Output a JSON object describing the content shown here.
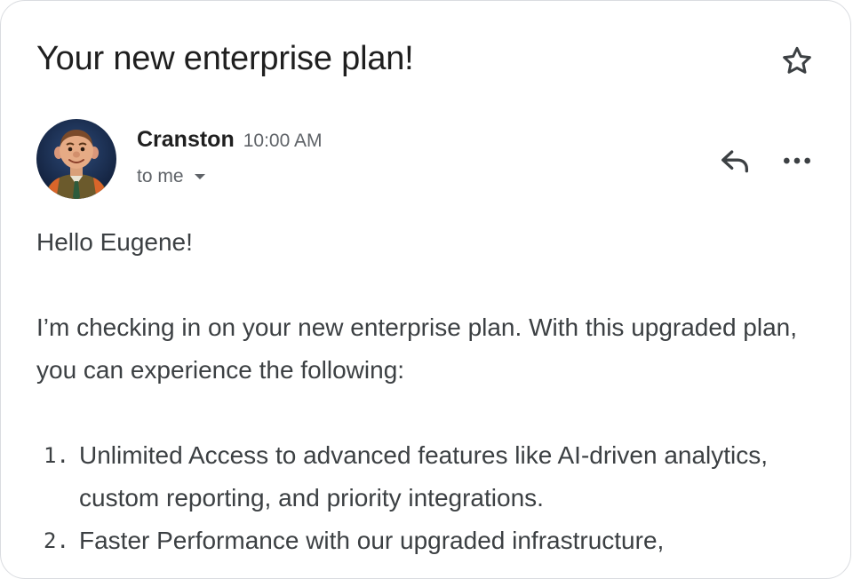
{
  "email": {
    "subject": "Your new enterprise plan!",
    "sender_name": "Cranston",
    "time": "10:00 AM",
    "recipient_label": "to me",
    "greeting": "Hello Eugene!",
    "intro": "I’m checking in on your new enterprise plan. With this upgraded plan, you can experience the following:",
    "list_items": [
      {
        "number": "1.",
        "text": "Unlimited Access to advanced features like AI-driven analytics, custom reporting, and priority integrations."
      },
      {
        "number": "2.",
        "text": "Faster Performance with our upgraded infrastructure,"
      }
    ]
  },
  "icons": {
    "star": "star-outline-icon",
    "reply": "reply-icon",
    "more": "more-horizontal-icon",
    "dropdown": "caret-down-icon"
  },
  "colors": {
    "text_primary": "#1f1f1f",
    "text_secondary": "#5f6368",
    "body_text": "#3c4043",
    "border": "#dadce0"
  }
}
